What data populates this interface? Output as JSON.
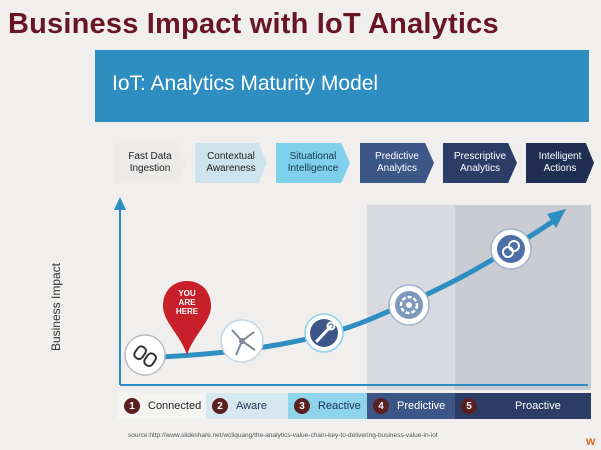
{
  "title": "Business Impact with IoT Analytics",
  "banner": {
    "title": "IoT: Analytics Maturity Model",
    "color": "#2e8dc1"
  },
  "stages": [
    {
      "label": "Fast Data\nIngestion",
      "bg": "#ecebe9",
      "fg": "#222"
    },
    {
      "label": "Contextual\nAwareness",
      "bg": "#cfe3ec",
      "fg": "#222"
    },
    {
      "label": "Situational\nIntelligence",
      "bg": "#7fd0ea",
      "fg": "#1b3553"
    },
    {
      "label": "Predictive\nAnalytics",
      "bg": "#3c5688",
      "fg": "#ffffff"
    },
    {
      "label": "Prescriptive\nAnalytics",
      "bg": "#2b3d66",
      "fg": "#ffffff"
    },
    {
      "label": "Intelligent\nActions",
      "bg": "#1f2e52",
      "fg": "#ffffff"
    }
  ],
  "yaxis_label": "Business Impact",
  "pin": {
    "text": "YOU\nARE\nHERE",
    "color": "#c8202a"
  },
  "levels": [
    {
      "num": "1",
      "label": "Connected",
      "bg": "#f4f4f2",
      "fg": "#222"
    },
    {
      "num": "2",
      "label": "Aware",
      "bg": "#d6e8ef",
      "fg": "#1b3553"
    },
    {
      "num": "3",
      "label": "Reactive",
      "bg": "#8fd4ea",
      "fg": "#1b3553"
    },
    {
      "num": "4",
      "label": "Predictive",
      "bg": "#3c5688",
      "fg": "#ffffff"
    },
    {
      "num": "5",
      "label": "Proactive",
      "bg": "#2b3d66",
      "fg": "#ffffff"
    }
  ],
  "icons": [
    "link-icon",
    "network-icon",
    "wrench-icon",
    "gear-cycle-icon",
    "refresh-icon"
  ],
  "source": "source:http://www.slideshare.net/wcliquang/the-analytics-value-chain-key-to-delivering-business-value-in-iot",
  "logo_text": "w"
}
